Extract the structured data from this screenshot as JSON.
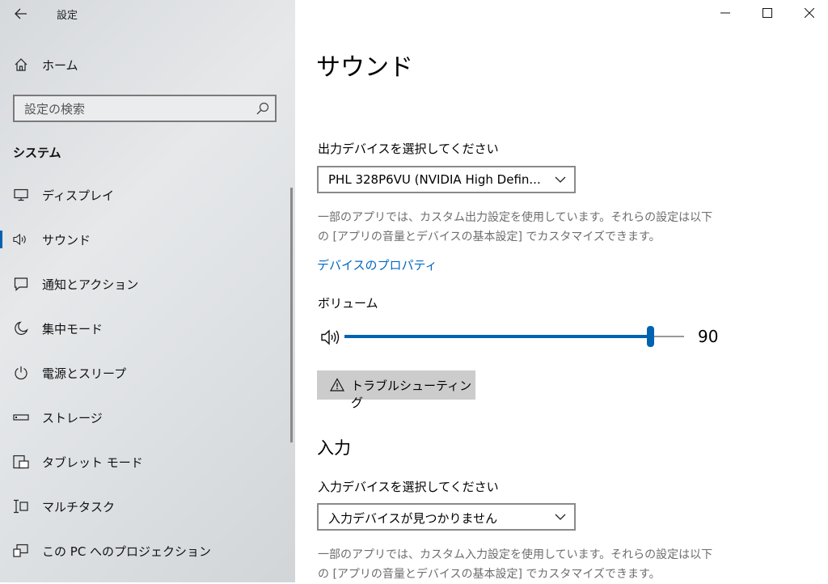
{
  "window": {
    "app_title": "設定",
    "controls": {
      "minimize": "minimize",
      "maximize": "maximize",
      "close": "close"
    }
  },
  "sidebar": {
    "home_label": "ホーム",
    "search": {
      "placeholder": "設定の検索"
    },
    "section_label": "システム",
    "items": [
      {
        "label": "ディスプレイ",
        "icon": "display-icon"
      },
      {
        "label": "サウンド",
        "icon": "speaker-icon",
        "selected": true
      },
      {
        "label": "通知とアクション",
        "icon": "notification-icon"
      },
      {
        "label": "集中モード",
        "icon": "moon-icon"
      },
      {
        "label": "電源とスリープ",
        "icon": "power-icon"
      },
      {
        "label": "ストレージ",
        "icon": "storage-icon"
      },
      {
        "label": "タブレット モード",
        "icon": "tablet-icon"
      },
      {
        "label": "マルチタスク",
        "icon": "multitask-icon"
      },
      {
        "label": "この PC へのプロジェクション",
        "icon": "projection-icon"
      }
    ]
  },
  "main": {
    "title": "サウンド",
    "output": {
      "label": "出力デバイスを選択してください",
      "selected_device": "PHL 328P6VU (NVIDIA High Defin...",
      "description_line1": "一部のアプリでは、カスタム出力設定を使用しています。それらの設定は以下",
      "description_line2": "の [アプリの音量とデバイスの基本設定] でカスタマイズできます。",
      "properties_link": "デバイスのプロパティ",
      "volume_label": "ボリューム",
      "volume_value": "90",
      "volume_fraction": 0.9,
      "troubleshoot_label": "トラブルシューティング"
    },
    "input": {
      "section_title": "入力",
      "label": "入力デバイスを選択してください",
      "selected_device": "入力デバイスが見つかりません",
      "description_line1": "一部のアプリでは、カスタム入力設定を使用しています。それらの設定は以下",
      "description_line2": "の [アプリの音量とデバイスの基本設定] でカスタマイズできます。"
    }
  },
  "colors": {
    "accent": "#0063b1",
    "link": "#0067c0",
    "description": "#6d6d6d"
  }
}
